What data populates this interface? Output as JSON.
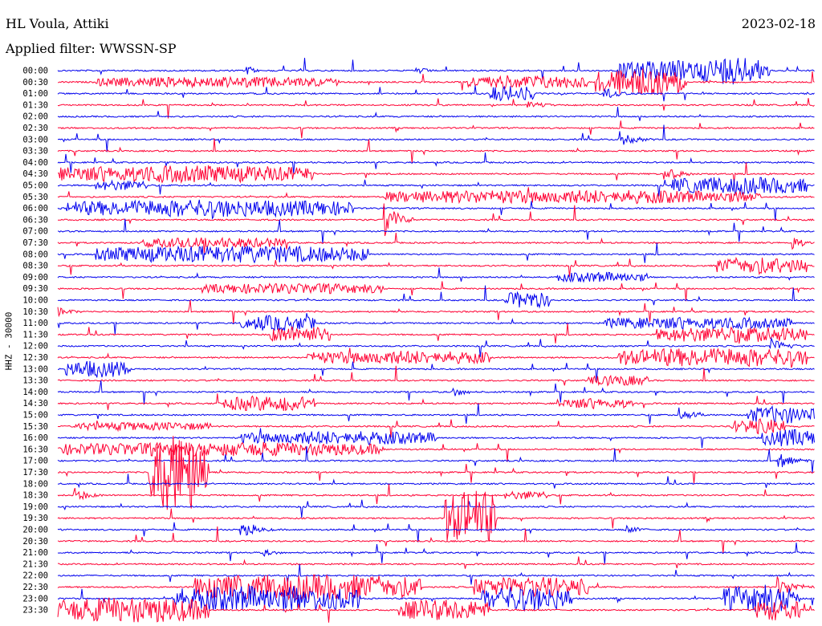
{
  "header": {
    "station": "HL Voula, Attiki",
    "date": "2023-02-18",
    "filter": "Applied filter: WWSSN-SP"
  },
  "axis": {
    "ylabel": "HHZ - 30000"
  },
  "colors": {
    "traceA": "#0000ee",
    "traceB": "#ff0033"
  },
  "chart_data": {
    "type": "line",
    "title": "HL Voula, Attiki",
    "subtitle": "Applied filter: WWSSN-SP",
    "ylabel": "HHZ - 30000",
    "date": "2023-02-18",
    "rows": [
      "00:00",
      "00:30",
      "01:00",
      "01:30",
      "02:00",
      "02:30",
      "03:00",
      "03:30",
      "04:00",
      "04:30",
      "05:00",
      "05:30",
      "06:00",
      "06:30",
      "07:00",
      "07:30",
      "08:00",
      "08:30",
      "09:00",
      "09:30",
      "10:00",
      "10:30",
      "11:00",
      "11:30",
      "12:00",
      "12:30",
      "13:00",
      "13:30",
      "14:00",
      "14:30",
      "15:00",
      "15:30",
      "16:00",
      "16:30",
      "17:00",
      "17:30",
      "18:00",
      "18:30",
      "19:00",
      "19:30",
      "20:00",
      "20:30",
      "21:00",
      "21:30",
      "22:00",
      "22:30",
      "23:00",
      "23:30"
    ],
    "series": [
      {
        "color": "blue",
        "rows": "00:00,01:00,...,23:00"
      },
      {
        "color": "red",
        "rows": "00:30,01:30,...,23:30"
      }
    ],
    "events": [
      {
        "row": "00:00",
        "t": 0.74,
        "amp": 1.2,
        "dur": 0.2
      },
      {
        "row": "00:00",
        "t": 0.85,
        "amp": 1.6,
        "dur": 0.08
      },
      {
        "row": "00:00",
        "t": 0.25,
        "amp": 0.7,
        "dur": 0.02
      },
      {
        "row": "00:00",
        "t": 0.47,
        "amp": 0.7,
        "dur": 0.03
      },
      {
        "row": "00:30",
        "t": 0.05,
        "amp": 0.6,
        "dur": 0.32
      },
      {
        "row": "00:30",
        "t": 0.54,
        "amp": 0.8,
        "dur": 0.16
      },
      {
        "row": "00:30",
        "t": 0.71,
        "amp": 1.6,
        "dur": 0.12
      },
      {
        "row": "00:30",
        "t": 0.8,
        "amp": 2.5,
        "dur": 0.02
      },
      {
        "row": "01:00",
        "t": 0.57,
        "amp": 0.9,
        "dur": 0.06
      },
      {
        "row": "01:00",
        "t": 0.72,
        "amp": 0.9,
        "dur": 0.04
      },
      {
        "row": "01:30",
        "t": 0.62,
        "amp": 0.5,
        "dur": 0.05
      },
      {
        "row": "03:00",
        "t": 0.74,
        "amp": 0.9,
        "dur": 0.05
      },
      {
        "row": "04:30",
        "t": 0.0,
        "amp": 1.0,
        "dur": 0.34
      },
      {
        "row": "04:30",
        "t": 0.8,
        "amp": 0.9,
        "dur": 0.05
      },
      {
        "row": "05:00",
        "t": 0.05,
        "amp": 0.6,
        "dur": 0.07
      },
      {
        "row": "05:00",
        "t": 0.81,
        "amp": 1.0,
        "dur": 0.18
      },
      {
        "row": "05:30",
        "t": 0.43,
        "amp": 0.8,
        "dur": 0.5
      },
      {
        "row": "06:00",
        "t": 0.01,
        "amp": 1.0,
        "dur": 0.38
      },
      {
        "row": "06:30",
        "t": 0.43,
        "amp": 2.2,
        "dur": 0.04
      },
      {
        "row": "07:30",
        "t": 0.11,
        "amp": 0.6,
        "dur": 0.19
      },
      {
        "row": "07:30",
        "t": 0.97,
        "amp": 1.0,
        "dur": 0.03
      },
      {
        "row": "08:00",
        "t": 0.05,
        "amp": 1.0,
        "dur": 0.36
      },
      {
        "row": "08:30",
        "t": 0.87,
        "amp": 1.0,
        "dur": 0.12
      },
      {
        "row": "09:00",
        "t": 0.66,
        "amp": 0.6,
        "dur": 0.12
      },
      {
        "row": "09:30",
        "t": 0.19,
        "amp": 0.6,
        "dur": 0.24
      },
      {
        "row": "10:00",
        "t": 0.59,
        "amp": 1.0,
        "dur": 0.06
      },
      {
        "row": "10:30",
        "t": 0.0,
        "amp": 0.6,
        "dur": 0.04
      },
      {
        "row": "11:00",
        "t": 0.24,
        "amp": 0.9,
        "dur": 0.1
      },
      {
        "row": "11:00",
        "t": 0.72,
        "amp": 0.7,
        "dur": 0.25
      },
      {
        "row": "11:30",
        "t": 0.28,
        "amp": 1.0,
        "dur": 0.08
      },
      {
        "row": "11:30",
        "t": 0.79,
        "amp": 0.9,
        "dur": 0.2
      },
      {
        "row": "12:00",
        "t": 0.94,
        "amp": 1.0,
        "dur": 0.05
      },
      {
        "row": "12:30",
        "t": 0.33,
        "amp": 0.8,
        "dur": 0.24
      },
      {
        "row": "12:30",
        "t": 0.74,
        "amp": 1.1,
        "dur": 0.25
      },
      {
        "row": "13:00",
        "t": 0.01,
        "amp": 1.0,
        "dur": 0.08
      },
      {
        "row": "13:30",
        "t": 0.7,
        "amp": 0.6,
        "dur": 0.08
      },
      {
        "row": "14:00",
        "t": 0.52,
        "amp": 0.7,
        "dur": 0.04
      },
      {
        "row": "14:30",
        "t": 0.22,
        "amp": 0.9,
        "dur": 0.12
      },
      {
        "row": "14:30",
        "t": 0.66,
        "amp": 0.6,
        "dur": 0.1
      },
      {
        "row": "15:00",
        "t": 0.82,
        "amp": 0.9,
        "dur": 0.04
      },
      {
        "row": "15:00",
        "t": 0.91,
        "amp": 1.0,
        "dur": 0.09
      },
      {
        "row": "15:30",
        "t": 0.02,
        "amp": 0.5,
        "dur": 0.18
      },
      {
        "row": "15:30",
        "t": 0.89,
        "amp": 0.9,
        "dur": 0.07
      },
      {
        "row": "16:00",
        "t": 0.24,
        "amp": 0.8,
        "dur": 0.26
      },
      {
        "row": "16:00",
        "t": 0.93,
        "amp": 1.0,
        "dur": 0.07
      },
      {
        "row": "16:30",
        "t": 0.0,
        "amp": 0.8,
        "dur": 0.43
      },
      {
        "row": "17:00",
        "t": 0.95,
        "amp": 1.0,
        "dur": 0.05
      },
      {
        "row": "17:30",
        "t": 0.12,
        "amp": 4.6,
        "dur": 0.08
      },
      {
        "row": "18:30",
        "t": 0.02,
        "amp": 1.0,
        "dur": 0.04
      },
      {
        "row": "18:30",
        "t": 0.59,
        "amp": 0.5,
        "dur": 0.06
      },
      {
        "row": "19:30",
        "t": 0.51,
        "amp": 3.3,
        "dur": 0.07
      },
      {
        "row": "20:00",
        "t": 0.24,
        "amp": 1.0,
        "dur": 0.05
      },
      {
        "row": "20:00",
        "t": 0.75,
        "amp": 0.6,
        "dur": 0.04
      },
      {
        "row": "21:00",
        "t": 0.27,
        "amp": 0.5,
        "dur": 0.04
      },
      {
        "row": "22:30",
        "t": 0.18,
        "amp": 1.5,
        "dur": 0.3
      },
      {
        "row": "22:30",
        "t": 0.55,
        "amp": 1.2,
        "dur": 0.15
      },
      {
        "row": "22:30",
        "t": 0.95,
        "amp": 1.3,
        "dur": 0.05
      },
      {
        "row": "23:00",
        "t": 0.15,
        "amp": 1.5,
        "dur": 0.25
      },
      {
        "row": "23:00",
        "t": 0.56,
        "amp": 1.4,
        "dur": 0.12
      },
      {
        "row": "23:00",
        "t": 0.88,
        "amp": 1.6,
        "dur": 0.1
      },
      {
        "row": "23:30",
        "t": 0.0,
        "amp": 1.5,
        "dur": 0.2
      },
      {
        "row": "23:30",
        "t": 0.45,
        "amp": 1.2,
        "dur": 0.12
      },
      {
        "row": "23:30",
        "t": 0.92,
        "amp": 1.2,
        "dur": 0.06
      }
    ]
  }
}
